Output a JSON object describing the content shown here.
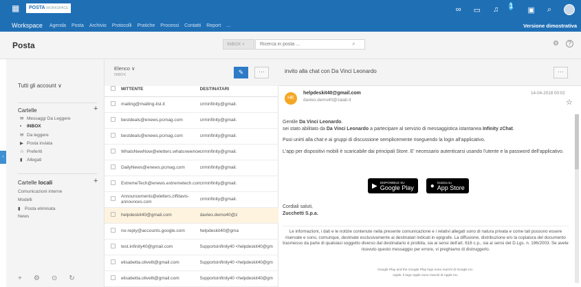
{
  "topbar": {
    "brand": "POSTA",
    "brand_sub": "WORKSPACE",
    "notification_count": "1",
    "workspace": "Workspace",
    "nav": [
      "Agenda",
      "Posta",
      "Archivio",
      "Protocolli",
      "Pratiche",
      "Processi",
      "Contatti",
      "Report",
      "..."
    ],
    "demo_label": "Versione dimostrativa"
  },
  "titlebar": {
    "title": "Posta",
    "folder_chip": "INBOX ×",
    "search_placeholder": "Ricerca in posta ..."
  },
  "sidebar": {
    "account": "Tutti gli account ∨",
    "cartelle_title": "Cartelle",
    "cartelle_items": [
      {
        "label": "Messaggi Da Leggere",
        "icon": "envelope-icon"
      },
      {
        "label": "INBOX",
        "icon": "inbox-icon"
      },
      {
        "label": "Da leggere",
        "icon": "envelope-icon"
      },
      {
        "label": "Posta inviata",
        "icon": "send-icon"
      },
      {
        "label": "Preferiti",
        "icon": "star-icon"
      },
      {
        "label": "Allegati",
        "icon": "paperclip-icon"
      }
    ],
    "local_title_a": "Cartelle ",
    "local_title_b": "locali",
    "local_items": [
      {
        "label": "Comunicazioni interne",
        "icon": ""
      },
      {
        "label": "Modelli",
        "icon": ""
      },
      {
        "label": "Posta eliminata",
        "icon": "trash-icon"
      },
      {
        "label": "News",
        "icon": ""
      }
    ],
    "plus": "+"
  },
  "maillist": {
    "elenco": "Elenco ∨",
    "elenco_sub": "INBOX",
    "columns": [
      "MITTENTE",
      "DESTINATARI"
    ],
    "rows": [
      {
        "from": "mailing@mailing-list.it",
        "to": "crminfinity@gmail."
      },
      {
        "from": "bestdeals@enews.pcmag.com",
        "to": "crminfinity@gmail."
      },
      {
        "from": "bestdeals@enews.pcmag.com",
        "to": "crminfinity@gmail."
      },
      {
        "from": "WhatsNewNow@eletters.whatsnewnow.com",
        "to": "crminfinity@gmail."
      },
      {
        "from": "DailyNews@enews.pcmag.com",
        "to": "crminfinity@gmail."
      },
      {
        "from": "ExtremeTech@enews.extremetech.com",
        "to": "crminfinity@gmail."
      },
      {
        "from": "Announcements@eletters.ziffdavis-announces.com",
        "to": "crminfinity@gmail."
      },
      {
        "from": "helpdeskit40@gmail.com",
        "to": "davleo.demo40@z"
      },
      {
        "from": "no-reply@accounts.google.com",
        "to": "helpdeskit40@gma"
      },
      {
        "from": "test.infinity40@gmail.com",
        "to": "Supportoinfinity40 <helpdeskit40@gm"
      },
      {
        "from": "elisabetta.olivelli@gmail.com",
        "to": "Supportoinfinity40 <helpdeskit40@gm"
      },
      {
        "from": "elisabetta.olivelli@gmail.com",
        "to": "Supportoinfinity40 <helpdeskit40@gm"
      }
    ]
  },
  "reader": {
    "subject": "invito alla chat con Da Vinci Leonardo",
    "avatar": "HE",
    "sender": "helpdeskit40@gmail.com",
    "sender_to": "davleo.demo40@zalab.it",
    "date": "14-04-2018 00:02",
    "greeting": "Gentile ",
    "greeting_name": "Da Vinci Leonardo",
    "line1_a": "sei stato abilitato da ",
    "line1_b": "Da Vinci Leonardo",
    "line1_c": " a partecipare al servizio di messaggistica istantanea ",
    "line1_d": "Infinity zChat",
    "line1_e": ".",
    "para2": "Puoi unirti alla chat e ai gruppi di discussione semplicemente riseguendo la login all'applicativo.",
    "para3": "L'app per dispositivi mobili è scaricabile dai principali Store. E' necessario autenticarsi usando l'utente e la password dell'applicativo.",
    "gplay_small": "DISPONIBILE SU",
    "gplay_big": "Google Play",
    "appstore_small": "Scarica su",
    "appstore_big": "App Store",
    "closing": "Cordiali saluti,",
    "company": "Zucchetti S.p.a.",
    "disclaimer": "Le informazioni, i dati e le notizie contenute nella presente comunicazione e i relativi allegati sono di natura privata e come tali possono essere riservate e sono, comunque, destinate esclusivamente ai destinatari indicati in epigrafe. La diffusione, distribuzione e/o la copiatura del documento trasmesso da parte di qualsiasi soggetto diverso dal destinatario è proibita, sia ai sensi dell'art. 616 c.p., sia ai sensi del D.Lgs. n. 196/2003. Se avete ricevuto questo messaggio per errore, vi preghiamo di distruggerlo.",
    "legal1": "Google Play and the Google Play logo sono marchi di Google Inc.",
    "legal2": "Apple, il logo Apple sono marchi di Apple Inc."
  },
  "colors": {
    "brand_blue": "#1f6fb5",
    "compose_blue": "#2e7bc6",
    "avatar_orange": "#f5a623",
    "selected_row": "#fdf3df"
  }
}
